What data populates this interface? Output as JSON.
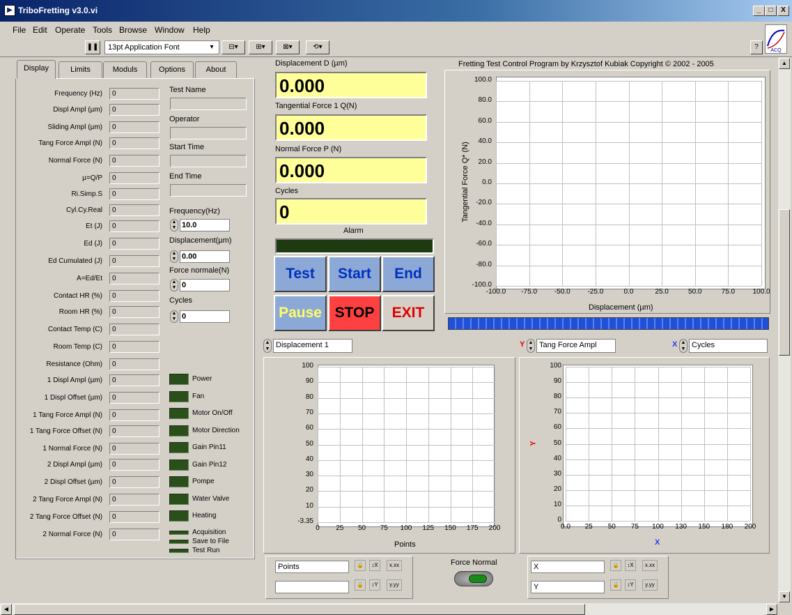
{
  "window": {
    "title": "TriboFretting v3.0.vi",
    "min": "_",
    "max": "□",
    "close": "X"
  },
  "menu": [
    "File",
    "Edit",
    "Operate",
    "Tools",
    "Browse",
    "Window",
    "Help"
  ],
  "toolbar": {
    "font": "13pt Application Font",
    "pause": "❚❚",
    "help": "?",
    "logo": "ACQ"
  },
  "tabs": [
    "Display",
    "Limits",
    "Moduls",
    "Options",
    "About"
  ],
  "fields": [
    {
      "label": "Frequency (Hz)",
      "value": "0"
    },
    {
      "label": "Displ Ampl (µm)",
      "value": "0"
    },
    {
      "label": "Sliding Ampl (µm)",
      "value": "0"
    },
    {
      "label": "Tang Force Ampl (N)",
      "value": "0"
    },
    {
      "label": "Normal Force (N)",
      "value": "0"
    },
    {
      "label": "µ=Q/P",
      "value": "0"
    },
    {
      "label": "Ri.Simp.S",
      "value": "0"
    },
    {
      "label": "Cyl.Cy.Real",
      "value": "0"
    },
    {
      "label": "Et (J)",
      "value": "0"
    },
    {
      "label": "Ed (J)",
      "value": "0"
    },
    {
      "label": "Ed Cumulated (J)",
      "value": "0"
    },
    {
      "label": "A=Ed/Et",
      "value": "0"
    },
    {
      "label": "Contact HR (%)",
      "value": "0"
    },
    {
      "label": "Room HR (%)",
      "value": "0"
    },
    {
      "label": "Contact Temp (C)",
      "value": "0"
    },
    {
      "label": "Room Temp (C)",
      "value": "0"
    },
    {
      "label": "Resistance (Ohm)",
      "value": "0"
    },
    {
      "label": "1 Displ Ampl (µm)",
      "value": "0"
    },
    {
      "label": "1 Displ Offset (µm)",
      "value": "0"
    },
    {
      "label": "1 Tang Force Ampl (N)",
      "value": "0"
    },
    {
      "label": "1 Tang Force Offset (N)",
      "value": "0"
    },
    {
      "label": "1 Normal Force (N)",
      "value": "0"
    },
    {
      "label": "2 Displ Ampl (µm)",
      "value": "0"
    },
    {
      "label": "2 Displ Offset (µm)",
      "value": "0"
    },
    {
      "label": "2 Tang Force Ampl (N)",
      "value": "0"
    },
    {
      "label": "2 Tang Force Offset (N)",
      "value": "0"
    },
    {
      "label": "2 Normal Force (N)",
      "value": "0"
    }
  ],
  "test": {
    "name_label": "Test Name",
    "name": "",
    "operator_label": "Operator",
    "operator": "",
    "start_label": "Start Time",
    "start": "",
    "end_label": "End Time",
    "end": ""
  },
  "controls": [
    {
      "label": "Frequency(Hz)",
      "value": "10.0"
    },
    {
      "label": "Displacement(µm)",
      "value": "0.00"
    },
    {
      "label": "Force normale(N)",
      "value": "0"
    },
    {
      "label": "Cycles",
      "value": "0"
    }
  ],
  "leds": [
    "Power",
    "Fan",
    "Motor On/Off",
    "Motor Direction",
    "Gain Pin11",
    "Gain Pin12",
    "Pompe",
    "Water Valve",
    "Heating"
  ],
  "small_leds": [
    "Acquisition",
    "Save to File",
    "Test Run"
  ],
  "displays": [
    {
      "label": "Displacement D (µm)",
      "value": "0.000"
    },
    {
      "label": "Tangential Force 1 Q(N)",
      "value": "0.000"
    },
    {
      "label": "Normal Force P (N)",
      "value": "0.000"
    },
    {
      "label": "Cycles",
      "value": "0"
    }
  ],
  "alarm_label": "Alarm",
  "buttons": {
    "test": "Test",
    "start": "Start",
    "end": "End",
    "pause": "Pause",
    "stop": "STOP",
    "exit": "EXIT"
  },
  "colors": {
    "yellow": "#ffff99",
    "stop": "#ff4040",
    "exit": "#e00000",
    "blue_text": "#0030c0",
    "pause_text": "#ffff66"
  },
  "main_graph": {
    "title": "Fretting Test Control Program by Krzysztof Kubiak Copyright © 2002 - 2005",
    "ylabel": "Tangential Force Q* (N)",
    "xlabel": "Displacement (µm)",
    "yticks": [
      "100.0",
      "80.0",
      "60.0",
      "40.0",
      "20.0",
      "0.0",
      "-20.0",
      "-40.0",
      "-60.0",
      "-80.0",
      "-100.0"
    ],
    "xticks": [
      "-100.0",
      "-75.0",
      "-50.0",
      "-25.0",
      "0.0",
      "25.0",
      "50.0",
      "75.0",
      "100.0"
    ]
  },
  "left_graph": {
    "selector": "Displacement 1",
    "xlabel": "Points",
    "yticks": [
      "100",
      "90",
      "80",
      "70",
      "60",
      "50",
      "40",
      "30",
      "20",
      "10",
      "-3.35"
    ],
    "xticks": [
      "0",
      "25",
      "50",
      "75",
      "100",
      "125",
      "150",
      "175",
      "200"
    ],
    "scale_x": "Points",
    "scale_y": ""
  },
  "right_graph": {
    "y_letter": "Y",
    "y_selector": "Tang Force Ampl",
    "x_letter": "X",
    "x_selector": "Cycles",
    "ylabel": "Y",
    "xlabel": "X",
    "yticks": [
      "100",
      "90",
      "80",
      "70",
      "60",
      "50",
      "40",
      "30",
      "20",
      "10",
      "0"
    ],
    "xticks": [
      "0.0",
      "25",
      "50",
      "75",
      "100",
      "130",
      "150",
      "180",
      "200"
    ],
    "scale_x": "X",
    "scale_y": "Y"
  },
  "force_normal_label": "Force Normal"
}
